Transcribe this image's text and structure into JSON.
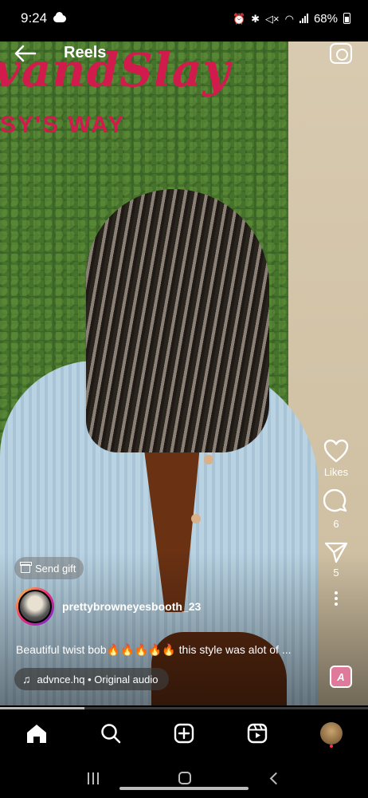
{
  "status_bar": {
    "time": "9:24",
    "battery": "68%",
    "icons": [
      "cloud-icon",
      "alarm-icon",
      "bluetooth-icon",
      "mute-icon",
      "wifi-icon",
      "signal-icon",
      "battery-icon"
    ]
  },
  "header": {
    "title": "Reels",
    "back_icon": "arrow-left-icon",
    "camera_icon": "camera-icon"
  },
  "video": {
    "sign_line1": "vandSlay",
    "sign_line2": "SY'S WAY"
  },
  "actions": {
    "likes_label": "Likes",
    "comments_count": "6",
    "shares_count": "5"
  },
  "overlay": {
    "send_gift_label": "Send gift",
    "username": "prettybrowneyesbooth_23",
    "caption": "Beautiful twist bob🔥🔥🔥🔥🔥 this style was alot of ...",
    "audio": "advnce.hq • Original audio"
  },
  "progress": {
    "fraction": 0.23
  },
  "bottom_nav": {
    "items": [
      "home-icon",
      "search-icon",
      "create-icon",
      "reels-icon",
      "profile-avatar"
    ],
    "active": "home-icon"
  },
  "colors": {
    "accent_pink": "#d21b4d",
    "notify": "#ff2d55"
  }
}
